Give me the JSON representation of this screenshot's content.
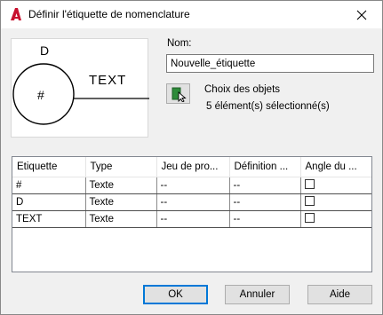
{
  "window": {
    "title": "Définir l'étiquette de nomenclature",
    "app_icon": "autocad-logo-icon",
    "close_icon": "close-icon"
  },
  "preview": {
    "label_top": "D",
    "label_center": "#",
    "label_right": "TEXT"
  },
  "nom": {
    "label": "Nom:",
    "value": "Nouvelle_étiquette"
  },
  "selection": {
    "button_icon": "select-objects-icon",
    "label": "Choix des objets",
    "count_text": "5 élément(s) sélectionné(s)"
  },
  "grid": {
    "columns": [
      "Etiquette",
      "Type",
      "Jeu de pro...",
      "Définition ...",
      "Angle du ..."
    ],
    "rows": [
      {
        "etiquette": "#",
        "type": "Texte",
        "jeu": "--",
        "definition": "--",
        "angle_checked": false
      },
      {
        "etiquette": "D",
        "type": "Texte",
        "jeu": "--",
        "definition": "--",
        "angle_checked": false
      },
      {
        "etiquette": "TEXT",
        "type": "Texte",
        "jeu": "--",
        "definition": "--",
        "angle_checked": false
      }
    ]
  },
  "buttons": {
    "ok": "OK",
    "annuler": "Annuler",
    "aide": "Aide"
  },
  "colors": {
    "accent": "#0078d7",
    "app_red": "#c8102e",
    "pick_green": "#2e8b3a"
  }
}
